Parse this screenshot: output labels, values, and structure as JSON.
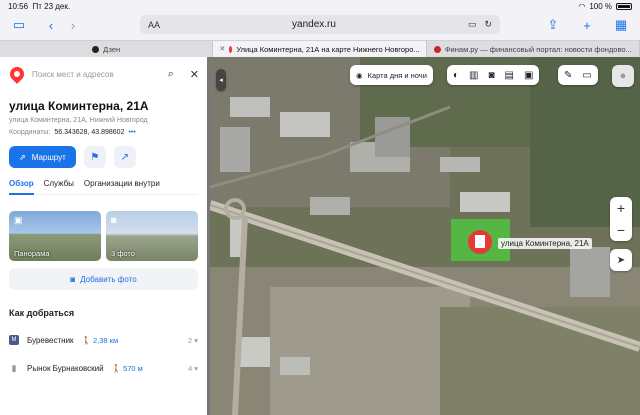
{
  "status": {
    "time": "10:56",
    "date": "Пт 23 дек.",
    "battery": "100 %"
  },
  "browser": {
    "aa": "AA",
    "host": "yandex.ru"
  },
  "tabs": [
    {
      "label": "Дзен",
      "color": "#222"
    },
    {
      "label": "Улица Коминтерна, 21А на карте Нижнего Новгоро...",
      "color": "#e53935"
    },
    {
      "label": "Финам.ру — финансовый портал: новости фондово...",
      "color": "#c62828"
    }
  ],
  "panel": {
    "search_placeholder": "Поиск мест и адресов",
    "title": "улица Коминтерна, 21А",
    "subtitle": "улица Коминтерна, 21А, Нижний Новгород",
    "coords_label": "Координаты:",
    "coords_value": "56.343628, 43.898602",
    "route_label": "Маршрут",
    "tabs": [
      "Обзор",
      "Службы",
      "Организации внутри"
    ],
    "photos": [
      {
        "caption": "Панорама"
      },
      {
        "caption": "3 фото"
      }
    ],
    "add_photo": "Добавить фото",
    "howto": "Как добраться",
    "stops": [
      {
        "name": "Буревестник",
        "distance": "2,38 км",
        "count": "2",
        "kind": "metro",
        "badge": "М"
      },
      {
        "name": "Рынок Бурнаковский",
        "distance": "570 м",
        "count": "4",
        "kind": "bus"
      }
    ]
  },
  "map": {
    "day_night": "Карта дня и ночи",
    "place_label": "улица Коминтерна, 21А",
    "zoom_in": "+",
    "zoom_out": "−"
  }
}
